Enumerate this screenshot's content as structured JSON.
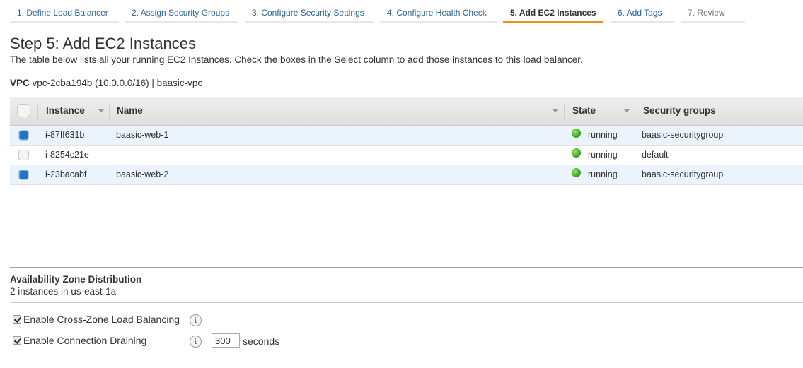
{
  "wizard": {
    "steps": [
      {
        "label": "1. Define Load Balancer",
        "state": "link"
      },
      {
        "label": "2. Assign Security Groups",
        "state": "link"
      },
      {
        "label": "3. Configure Security Settings",
        "state": "link"
      },
      {
        "label": "4. Configure Health Check",
        "state": "link"
      },
      {
        "label": "5. Add EC2 Instances",
        "state": "active"
      },
      {
        "label": "6. Add Tags",
        "state": "link"
      },
      {
        "label": "7. Review",
        "state": "disabled"
      }
    ],
    "active_color": "#f0901f"
  },
  "page": {
    "title": "Step 5: Add EC2 Instances",
    "description": "The table below lists all your running EC2 Instances. Check the boxes in the Select column to add those instances to this load balancer.",
    "vpc_label": "VPC",
    "vpc_value": "vpc-2cba194b (10.0.0.0/16) | baasic-vpc"
  },
  "table": {
    "columns": [
      "Instance",
      "Name",
      "State",
      "Security groups"
    ],
    "rows": [
      {
        "selected": true,
        "instance": "i-87ff631b",
        "name": "baasic-web-1",
        "state": "running",
        "security_group": "baasic-securitygroup"
      },
      {
        "selected": false,
        "instance": "i-8254c21e",
        "name": "",
        "state": "running",
        "security_group": "default"
      },
      {
        "selected": true,
        "instance": "i-23bacabf",
        "name": "baasic-web-2",
        "state": "running",
        "security_group": "baasic-securitygroup"
      }
    ],
    "selected_color": "#1f74c6",
    "running_color": "#3aaa1f"
  },
  "azd": {
    "title": "Availability Zone Distribution",
    "summary": "2 instances in us-east-1a"
  },
  "options": {
    "cross_zone": {
      "label": "Enable Cross-Zone Load Balancing",
      "checked": true,
      "info_icon": "i"
    },
    "draining": {
      "label": "Enable Connection Draining",
      "checked": true,
      "info_icon": "i",
      "timeout": "300",
      "unit": "seconds"
    }
  }
}
